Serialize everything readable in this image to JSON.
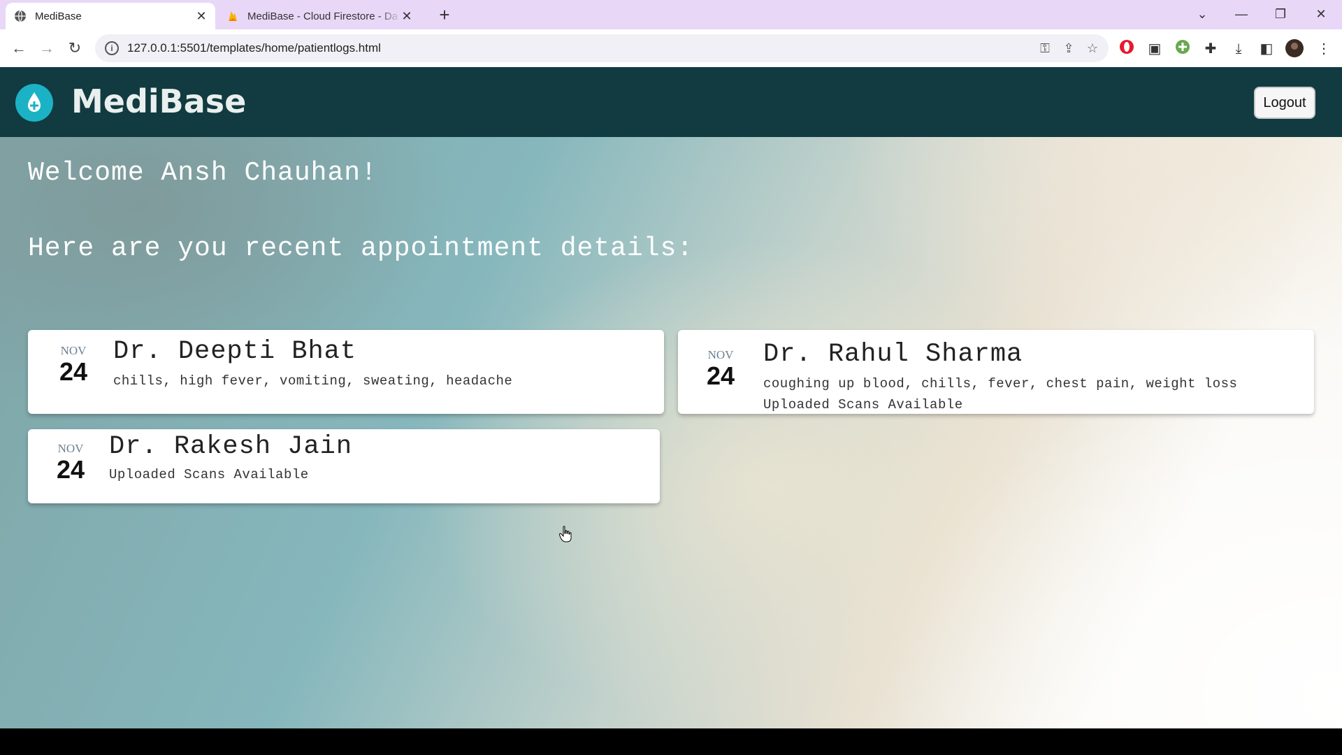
{
  "browser": {
    "tabs": [
      {
        "title": "MediBase",
        "active": true
      },
      {
        "title": "MediBase - Cloud Firestore - Da",
        "active": false
      }
    ],
    "url": "127.0.0.1:5501/templates/home/patientlogs.html"
  },
  "header": {
    "brand": "MediBase",
    "logout_label": "Logout"
  },
  "main": {
    "welcome": "Welcome Ansh Chauhan!",
    "subheading": "Here are you recent appointment details:"
  },
  "appointments": [
    {
      "month": "NOV",
      "day": "24",
      "doctor": "Dr. Deepti Bhat",
      "symptoms": "chills, high fever, vomiting, sweating, headache",
      "note": ""
    },
    {
      "month": "NOV",
      "day": "24",
      "doctor": "Dr. Rahul Sharma",
      "symptoms": "coughing up blood, chills, fever, chest pain, weight loss",
      "note": "Uploaded Scans Available"
    },
    {
      "month": "NOV",
      "day": "24",
      "doctor": "Dr. Rakesh Jain",
      "symptoms": "",
      "note": "Uploaded Scans Available"
    }
  ],
  "colors": {
    "header_bg": "#113b40",
    "logo": "#1cb2c6",
    "tabbar": "#e8d7f6"
  },
  "icons": [
    "globe-icon",
    "firebase-icon",
    "close-icon",
    "plus-icon",
    "back-icon",
    "forward-icon",
    "reload-icon",
    "info-icon",
    "key-icon",
    "share-icon",
    "star-icon",
    "opera-icon",
    "media-icon",
    "extension-icon",
    "puzzle-icon",
    "download-icon",
    "sidepanel-icon",
    "profile-avatar",
    "menu-icon",
    "drop-icon",
    "hand-cursor-icon"
  ]
}
